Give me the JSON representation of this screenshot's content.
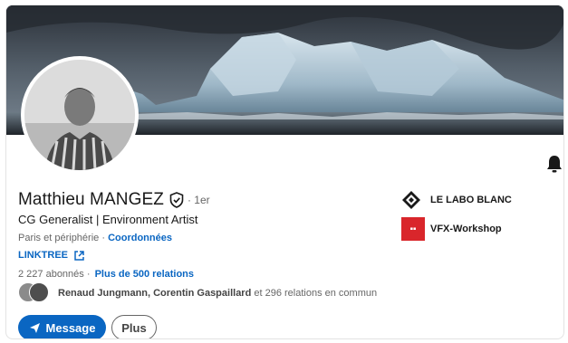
{
  "profile": {
    "name": "Matthieu MANGEZ",
    "degree": "· 1er",
    "headline": "CG Generalist | Environment Artist",
    "location": "Paris et périphérie",
    "location_separator": " · ",
    "contact_link": "Coordonnées",
    "website_link": "LINKTREE",
    "followers": "2 227 abonnés",
    "followers_separator": " · ",
    "connections": "Plus de 500 relations",
    "mutual_names": "Renaud Jungmann, Corentin Gaspaillard",
    "mutual_rest": " et 296 relations en commun"
  },
  "organizations": [
    {
      "name": "LE LABO BLANC",
      "logo": "diamond-logo-icon"
    },
    {
      "name": "VFX-Workshop",
      "logo": "vfx-workshop-logo-icon"
    }
  ],
  "actions": {
    "message_label": "Message",
    "more_label": "Plus"
  },
  "icons": {
    "bell": "bell-icon",
    "verified": "shield-check-icon",
    "external": "external-link-icon",
    "send": "paper-plane-icon"
  },
  "colors": {
    "accent": "#0a66c2",
    "text": "#191919",
    "muted": "#666666",
    "vfx_logo": "#d9262b"
  }
}
